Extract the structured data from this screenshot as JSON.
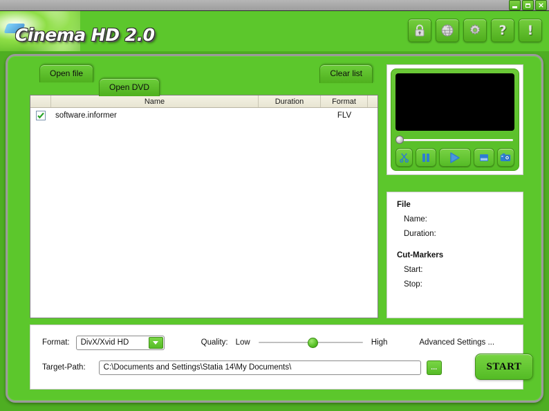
{
  "window": {
    "minimize_label": "",
    "maximize_label": "",
    "close_label": "×"
  },
  "header": {
    "title": "Cinema HD 2.0",
    "toolbar": [
      {
        "name": "lock-icon",
        "tooltip": "Register"
      },
      {
        "name": "globe-icon",
        "tooltip": "Website"
      },
      {
        "name": "gear-icon",
        "tooltip": "Settings"
      },
      {
        "name": "help-icon",
        "glyph": "?",
        "tooltip": "Help"
      },
      {
        "name": "info-icon",
        "glyph": "!",
        "tooltip": "About"
      }
    ]
  },
  "tabs": {
    "open_file": "Open file",
    "open_dvd": "Open DVD",
    "active": "Open DVD"
  },
  "buttons": {
    "clear_list": "Clear list",
    "start": "START",
    "browse": "...",
    "advanced_settings": "Advanced Settings ..."
  },
  "file_list": {
    "columns": [
      "",
      "Name",
      "Duration",
      "Format",
      ""
    ],
    "rows": [
      {
        "checked": true,
        "name": "software.informer",
        "duration": "",
        "format": "FLV"
      }
    ]
  },
  "player": {
    "controls": [
      {
        "name": "cut-button",
        "icon": "scissors-icon"
      },
      {
        "name": "pause-button",
        "icon": "pause-icon"
      },
      {
        "name": "play-button",
        "icon": "play-icon"
      },
      {
        "name": "stop-button",
        "icon": "stop-icon"
      },
      {
        "name": "snapshot-button",
        "icon": "camera-icon"
      }
    ],
    "seek_position_percent": 0
  },
  "info_panel": {
    "file_heading": "File",
    "name_label": "Name:",
    "duration_label": "Duration:",
    "cut_markers_heading": "Cut-Markers",
    "start_label": "Start:",
    "stop_label": "Stop:"
  },
  "settings": {
    "format_label": "Format:",
    "format_value": "DivX/Xvid HD",
    "format_options": [
      "DivX/Xvid HD"
    ],
    "quality_label": "Quality:",
    "quality_low": "Low",
    "quality_high": "High",
    "quality_percent": 52,
    "target_path_label": "Target-Path:",
    "target_path_value": "C:\\Documents and Settings\\Statia 14\\My Documents\\",
    "target_path_placeholder": ""
  },
  "colors": {
    "brand_green": "#5CC72C",
    "button_green": "#6CCD3A",
    "frame_gray": "#9A9A9A",
    "screen_black": "#000000",
    "icon_blue": "#2E7DD1"
  }
}
